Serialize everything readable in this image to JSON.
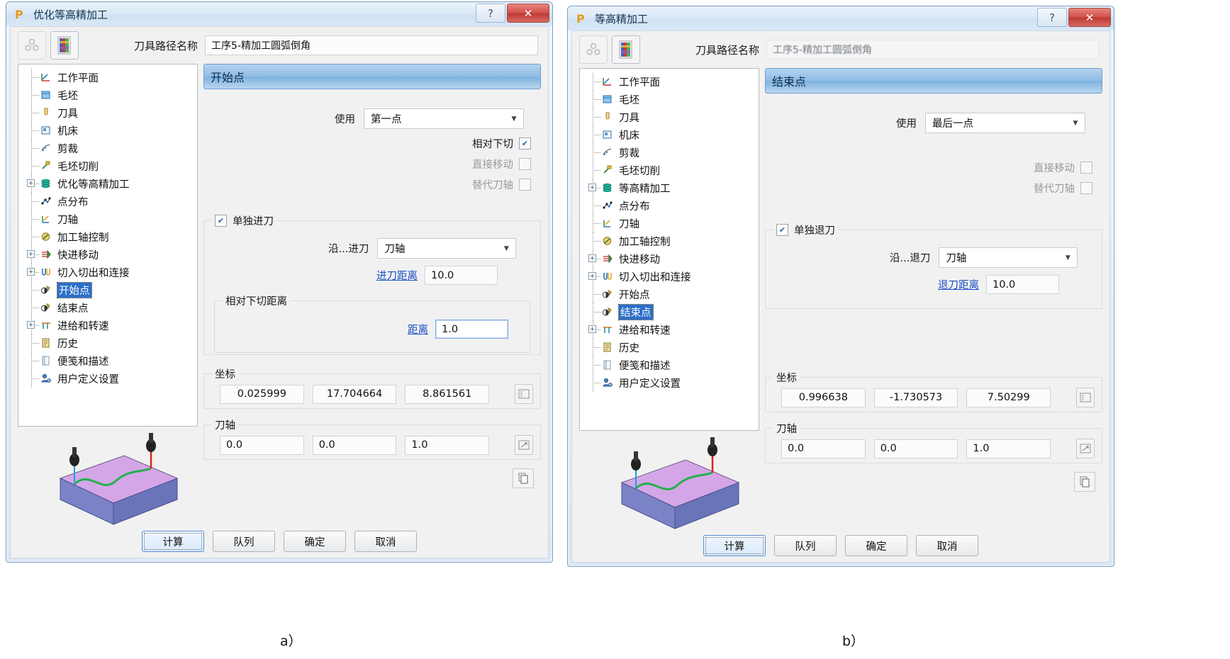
{
  "figure": {
    "caption_a": "a）",
    "caption_b": "b）"
  },
  "icons": {
    "app": "P",
    "help": "?",
    "close": "✕",
    "refresh": "refresh-icon",
    "thumbnail": "toolpath-thumbnail-icon",
    "chevron_down": "▼",
    "expand": "+",
    "coord_pick": "pick-coordinate-icon",
    "axis_pick": "pick-axis-icon",
    "copy": "copy-icon",
    "check": "✔"
  },
  "tree_items": [
    {
      "label": "工作平面",
      "icon": "workplane-icon",
      "expandable": false
    },
    {
      "label": "毛坯",
      "icon": "block-icon",
      "expandable": false
    },
    {
      "label": "刀具",
      "icon": "tool-icon",
      "expandable": false
    },
    {
      "label": "机床",
      "icon": "machine-tool-icon",
      "expandable": false
    },
    {
      "label": "剪裁",
      "icon": "trim-icon",
      "expandable": false
    },
    {
      "label": "毛坯切削",
      "icon": "stock-cutting-icon",
      "expandable": false
    },
    {
      "label": "优化等高精加工",
      "icon": "strategy-icon",
      "expandable": true
    },
    {
      "label": "点分布",
      "icon": "point-distribution-icon",
      "expandable": false
    },
    {
      "label": "刀轴",
      "icon": "tool-axis-icon",
      "expandable": false
    },
    {
      "label": "加工轴控制",
      "icon": "machine-axis-control-icon",
      "expandable": false
    },
    {
      "label": "快进移动",
      "icon": "rapid-move-icon",
      "expandable": true
    },
    {
      "label": "切入切出和连接",
      "icon": "lead-link-icon",
      "expandable": true
    },
    {
      "label": "开始点",
      "icon": "start-point-icon",
      "expandable": false,
      "selected": true
    },
    {
      "label": "结束点",
      "icon": "end-point-icon",
      "expandable": false
    },
    {
      "label": "进给和转速",
      "icon": "feeds-speeds-icon",
      "expandable": true
    },
    {
      "label": "历史",
      "icon": "history-icon",
      "expandable": false
    },
    {
      "label": "便笺和描述",
      "icon": "notes-icon",
      "expandable": false
    },
    {
      "label": "用户定义设置",
      "icon": "user-settings-icon",
      "expandable": false
    }
  ],
  "tree_items_b": [
    {
      "label": "工作平面",
      "icon": "workplane-icon",
      "expandable": false
    },
    {
      "label": "毛坯",
      "icon": "block-icon",
      "expandable": false
    },
    {
      "label": "刀具",
      "icon": "tool-icon",
      "expandable": false
    },
    {
      "label": "机床",
      "icon": "machine-tool-icon",
      "expandable": false
    },
    {
      "label": "剪裁",
      "icon": "trim-icon",
      "expandable": false
    },
    {
      "label": "毛坯切削",
      "icon": "stock-cutting-icon",
      "expandable": false
    },
    {
      "label": "等高精加工",
      "icon": "strategy-icon",
      "expandable": true
    },
    {
      "label": "点分布",
      "icon": "point-distribution-icon",
      "expandable": false
    },
    {
      "label": "刀轴",
      "icon": "tool-axis-icon",
      "expandable": false
    },
    {
      "label": "加工轴控制",
      "icon": "machine-axis-control-icon",
      "expandable": false
    },
    {
      "label": "快进移动",
      "icon": "rapid-move-icon",
      "expandable": true
    },
    {
      "label": "切入切出和连接",
      "icon": "lead-link-icon",
      "expandable": true
    },
    {
      "label": "开始点",
      "icon": "start-point-icon",
      "expandable": false
    },
    {
      "label": "结束点",
      "icon": "end-point-icon",
      "expandable": false,
      "selected": true
    },
    {
      "label": "进给和转速",
      "icon": "feeds-speeds-icon",
      "expandable": true
    },
    {
      "label": "历史",
      "icon": "history-icon",
      "expandable": false
    },
    {
      "label": "便笺和描述",
      "icon": "notes-icon",
      "expandable": false
    },
    {
      "label": "用户定义设置",
      "icon": "user-settings-icon",
      "expandable": false
    }
  ],
  "dialog_a": {
    "title": "优化等高精加工",
    "toolpath_label": "刀具路径名称",
    "toolpath_value": "工序5-精加工圆弧倒角",
    "pane_title": "开始点",
    "use_label": "使用",
    "use_value": "第一点",
    "check_relative_plunge": {
      "label": "相对下切",
      "checked": true,
      "enabled": true
    },
    "check_direct_move": {
      "label": "直接移动",
      "checked": false,
      "enabled": false
    },
    "check_alt_tool_axis": {
      "label": "替代刀轴",
      "checked": false,
      "enabled": false
    },
    "lead_group": {
      "title": "单独进刀",
      "checked": true,
      "along_label": "沿...进刀",
      "along_value": "刀轴",
      "distance_label": "进刀距离",
      "distance_value": "10.0",
      "sub_title": "相对下切距离",
      "sub_distance_label": "距离",
      "sub_distance_value": "1.0"
    },
    "coords": {
      "title": "坐标",
      "x": "0.025999",
      "y": "17.704664",
      "z": "8.861561"
    },
    "tool_axis": {
      "title": "刀轴",
      "i": "0.0",
      "j": "0.0",
      "k": "1.0"
    },
    "buttons": [
      "计算",
      "队列",
      "确定",
      "取消"
    ]
  },
  "dialog_b": {
    "title": "等高精加工",
    "toolpath_label": "刀具路径名称",
    "toolpath_value": "工序5-精加工圆弧倒角",
    "pane_title": "结束点",
    "use_label": "使用",
    "use_value": "最后一点",
    "check_direct_move": {
      "label": "直接移动",
      "checked": false,
      "enabled": false
    },
    "check_alt_tool_axis": {
      "label": "替代刀轴",
      "checked": false,
      "enabled": false
    },
    "lead_group": {
      "title": "单独退刀",
      "checked": true,
      "along_label": "沿...退刀",
      "along_value": "刀轴",
      "distance_label": "退刀距离",
      "distance_value": "10.0"
    },
    "coords": {
      "title": "坐标",
      "x": "0.996638",
      "y": "-1.730573",
      "z": "7.50299"
    },
    "tool_axis": {
      "title": "刀轴",
      "i": "0.0",
      "j": "0.0",
      "k": "1.0"
    },
    "buttons": [
      "计算",
      "队列",
      "确定",
      "取消"
    ]
  },
  "colors": {
    "accent": "#2b6fc9",
    "link": "#1a4fc4",
    "pane_header": "#8fbde5",
    "close_button": "#d3514b",
    "block_top": "#d4a6e8",
    "block_side": "#7b83c6",
    "toolpath_green": "#22b14c",
    "toolpath_red": "#e02020"
  }
}
